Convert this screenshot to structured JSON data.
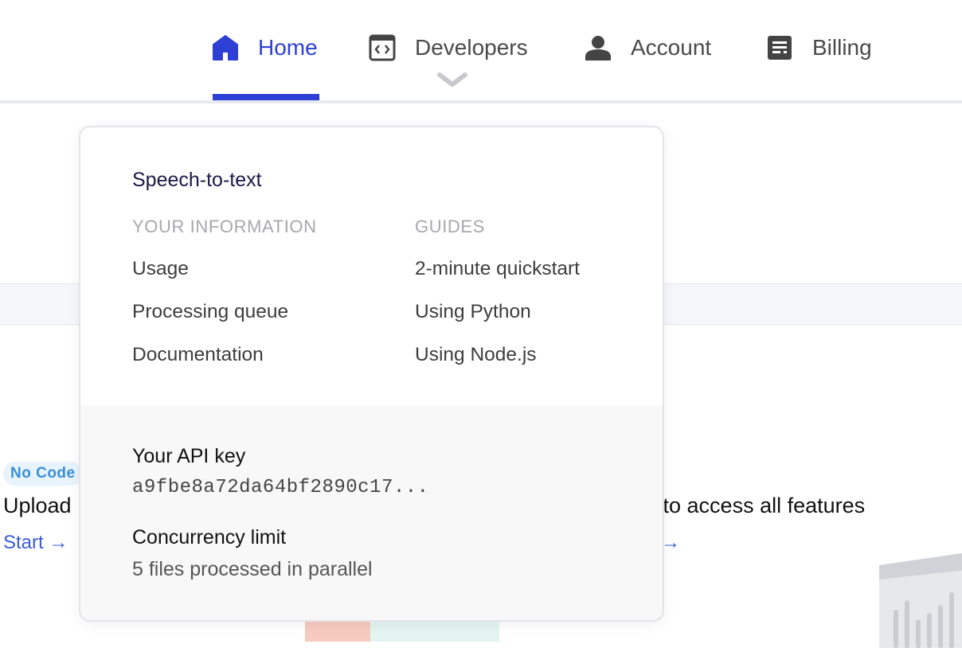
{
  "nav": {
    "items": [
      {
        "label": "Home",
        "icon": "home-icon",
        "active": true
      },
      {
        "label": "Developers",
        "icon": "code-window-icon",
        "active": false
      },
      {
        "label": "Account",
        "icon": "person-icon",
        "active": false
      },
      {
        "label": "Billing",
        "icon": "receipt-icon",
        "active": false
      }
    ]
  },
  "background": {
    "badge": "No Code",
    "upload_title": "Upload",
    "start_link": "Start →",
    "features_text": "e to access all features",
    "features_arrow": "→"
  },
  "dropdown": {
    "title": "Speech-to-text",
    "left_heading": "YOUR INFORMATION",
    "left_links": [
      "Usage",
      "Processing queue",
      "Documentation"
    ],
    "right_heading": "GUIDES",
    "right_links": [
      "2-minute quickstart",
      "Using Python",
      "Using Node.js"
    ],
    "api_label": "Your API key",
    "api_key": "a9fbe8a72da64bf2890c17...",
    "concurrency_label": "Concurrency limit",
    "concurrency_value": "5 files processed in parallel"
  },
  "colors": {
    "accent": "#2d3fd4",
    "link": "#3a5bd6",
    "badge_bg": "#e7f3fd"
  }
}
